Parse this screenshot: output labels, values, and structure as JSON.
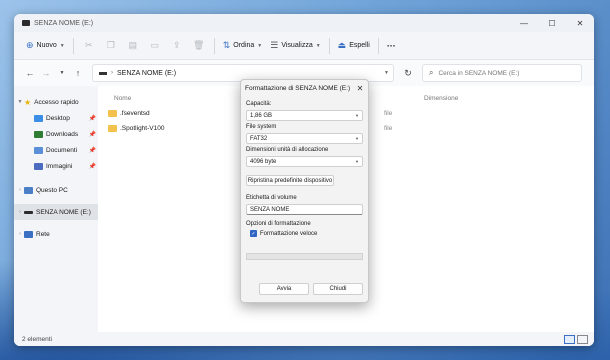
{
  "window": {
    "title": "SENZA NOME (E:)",
    "controls": {
      "minimize": "—",
      "maximize": "☐",
      "close": "✕"
    }
  },
  "toolbar": {
    "new_label": "Nuovo",
    "sort_label": "Ordina",
    "view_label": "Visualizza",
    "extract_label": "Espelli",
    "more_label": "···"
  },
  "navbar": {
    "address_text": "SENZA NOME (E:)",
    "search_placeholder": "Cerca in SENZA NOME (E:)"
  },
  "sidebar": {
    "quick_access": "Accesso rapido",
    "items": [
      {
        "label": "Desktop",
        "color": "#3a8ee6"
      },
      {
        "label": "Downloads",
        "color": "#2e7d32"
      },
      {
        "label": "Documenti",
        "color": "#5b8fd8"
      },
      {
        "label": "Immagini",
        "color": "#4b6cc1"
      }
    ],
    "this_pc": "Questo PC",
    "drive": "SENZA NOME (E:)",
    "network": "Rete"
  },
  "main": {
    "col_name": "Nome",
    "col_size": "Dimensione",
    "files": [
      {
        "name": ".fseventsd",
        "type": "file"
      },
      {
        "name": ".Spotlight-V100",
        "type": "file"
      }
    ]
  },
  "status": {
    "items": "2 elementi"
  },
  "dialog": {
    "title": "Formattazione di SENZA NOME (E:)",
    "capacity_label": "Capacità:",
    "capacity_value": "1,86 GB",
    "fs_label": "File system",
    "fs_value": "FAT32",
    "alloc_label": "Dimensioni unità di allocazione",
    "alloc_value": "4096 byte",
    "restore_label": "Ripristina predefinite dispositivo",
    "volume_label": "Etichetta di volume",
    "volume_value": "SENZA NOME",
    "options_label": "Opzioni di formattazione",
    "quick_format_label": "Formattazione veloce",
    "progress": 0,
    "start_label": "Avvia",
    "close_label": "Chiudi"
  }
}
